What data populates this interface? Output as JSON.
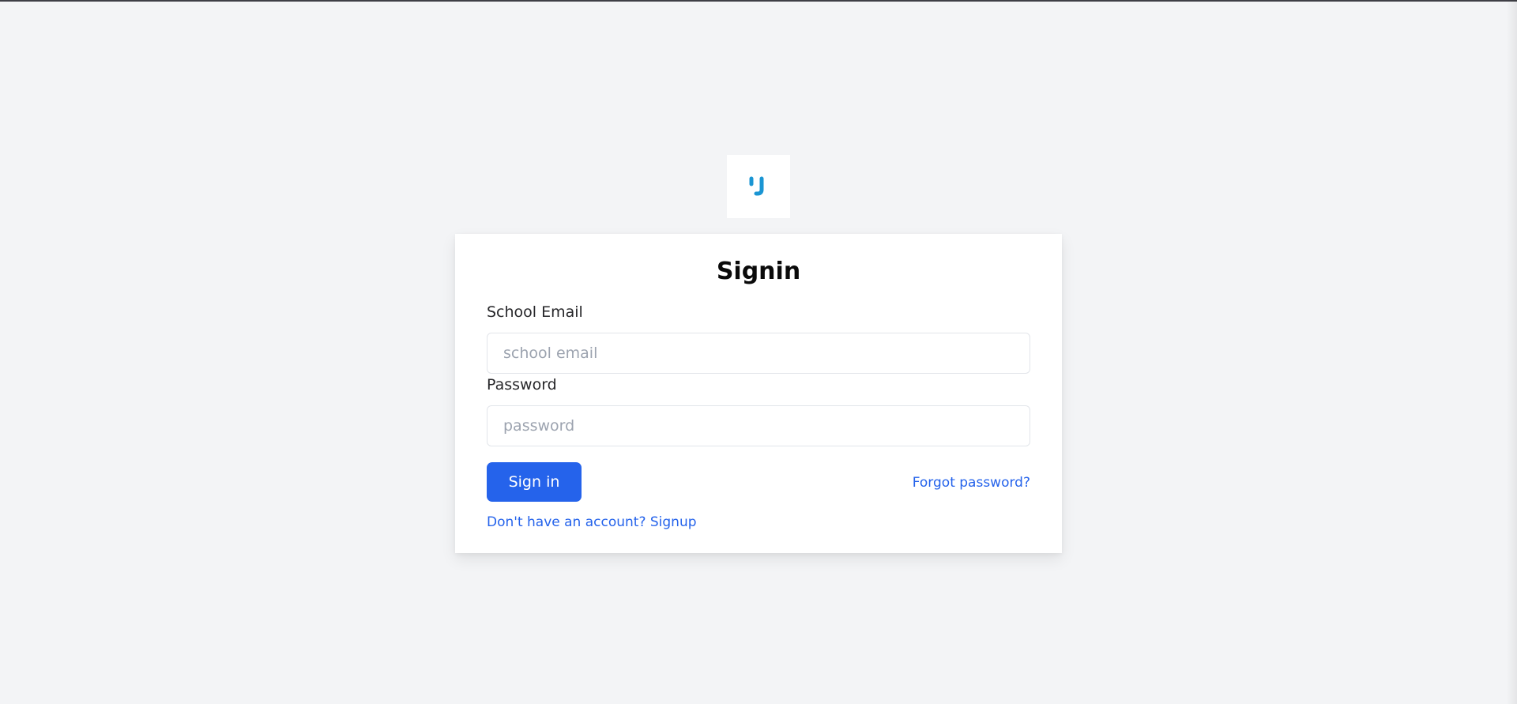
{
  "logo": {
    "icon": "stylized-u-logo-icon",
    "color": "#1a95d3"
  },
  "form": {
    "title": "Signin",
    "email": {
      "label": "School Email",
      "value": "",
      "placeholder": "school email"
    },
    "password": {
      "label": "Password",
      "value": "",
      "placeholder": "password"
    },
    "submit_label": "Sign in",
    "forgot_password_label": "Forgot password?",
    "signup_label": "Don't have an account? Signup"
  },
  "colors": {
    "background": "#f3f4f6",
    "card": "#ffffff",
    "primary": "#2563eb",
    "text": "#27272a"
  }
}
